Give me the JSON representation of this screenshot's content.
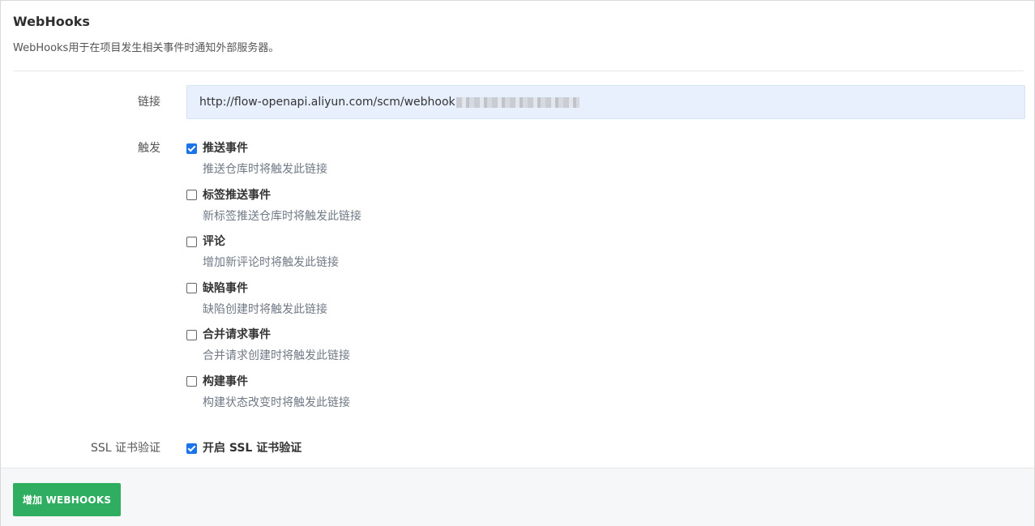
{
  "header": {
    "title": "WebHooks",
    "description": "WebHooks用于在项目发生相关事件时通知外部服务器。"
  },
  "form": {
    "url_label": "链接",
    "url_value": "http://flow-openapi.aliyun.com/scm/webhook",
    "trigger_label": "触发",
    "ssl_label": "SSL 证书验证",
    "ssl_option": {
      "label": "开启 SSL 证书验证",
      "checked": true
    }
  },
  "triggers": [
    {
      "label": "推送事件",
      "help": "推送仓库时将触发此链接",
      "checked": true
    },
    {
      "label": "标签推送事件",
      "help": "新标签推送仓库时将触发此链接",
      "checked": false
    },
    {
      "label": "评论",
      "help": "增加新评论时将触发此链接",
      "checked": false
    },
    {
      "label": "缺陷事件",
      "help": "缺陷创建时将触发此链接",
      "checked": false
    },
    {
      "label": "合并请求事件",
      "help": "合并请求创建时将触发此链接",
      "checked": false
    },
    {
      "label": "构建事件",
      "help": "构建状态改变时将触发此链接",
      "checked": false
    }
  ],
  "footer": {
    "add_button_label": "增加 WEBHOOKS"
  },
  "colors": {
    "accent_blue": "#1a73e8",
    "button_green": "#2fae61",
    "url_background": "#e8f0fe"
  }
}
